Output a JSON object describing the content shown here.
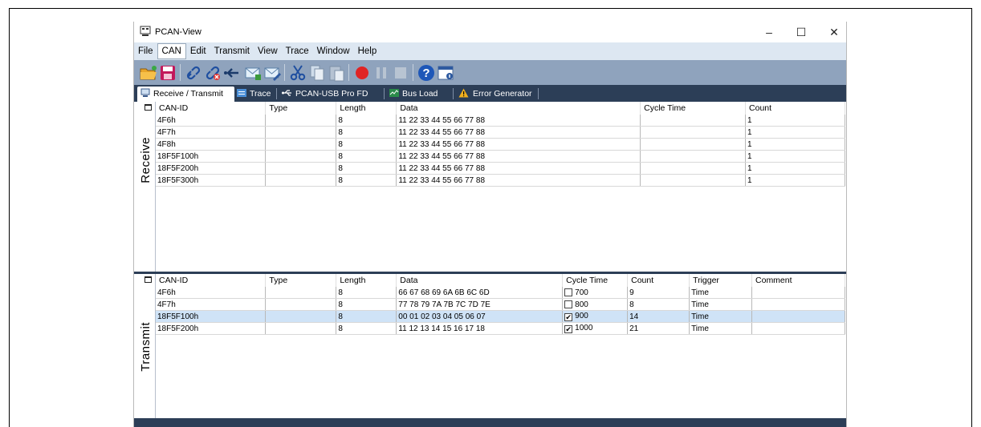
{
  "window": {
    "title": "PCAN-View",
    "minimize": "–",
    "maximize": "☐",
    "close": "✕"
  },
  "menu": [
    "File",
    "CAN",
    "Edit",
    "Transmit",
    "View",
    "Trace",
    "Window",
    "Help"
  ],
  "menu_active": "CAN",
  "toolbar": [
    "open-icon",
    "save-icon",
    "connect-icon",
    "disconnect-icon",
    "reset-icon",
    "new-message-icon",
    "edit-message-icon",
    "cut-icon",
    "copy-icon",
    "paste-icon",
    "record-icon",
    "pause-icon",
    "stop-icon",
    "help-icon",
    "about-icon"
  ],
  "tabs": [
    {
      "label": "Receive / Transmit",
      "icon": "monitor-icon"
    },
    {
      "label": "Trace",
      "icon": "trace-icon"
    },
    {
      "label": "PCAN-USB Pro FD",
      "icon": "usb-icon"
    },
    {
      "label": "Bus Load",
      "icon": "busload-icon"
    },
    {
      "label": "Error Generator",
      "icon": "warning-icon"
    }
  ],
  "receive": {
    "label": "Receive",
    "columns": [
      "CAN-ID",
      "Type",
      "Length",
      "Data",
      "Cycle Time",
      "Count"
    ],
    "rows": [
      {
        "id": "4F6h",
        "type": "",
        "length": "8",
        "data": "11 22 33 44 55 66 77 88",
        "cycle": "",
        "count": "1"
      },
      {
        "id": "4F7h",
        "type": "",
        "length": "8",
        "data": "11 22 33 44 55 66 77 88",
        "cycle": "",
        "count": "1"
      },
      {
        "id": "4F8h",
        "type": "",
        "length": "8",
        "data": "11 22 33 44 55 66 77 88",
        "cycle": "",
        "count": "1"
      },
      {
        "id": "18F5F100h",
        "type": "",
        "length": "8",
        "data": "11 22 33 44 55 66 77 88",
        "cycle": "",
        "count": "1"
      },
      {
        "id": "18F5F200h",
        "type": "",
        "length": "8",
        "data": "11 22 33 44 55 66 77 88",
        "cycle": "",
        "count": "1"
      },
      {
        "id": "18F5F300h",
        "type": "",
        "length": "8",
        "data": "11 22 33 44 55 66 77 88",
        "cycle": "",
        "count": "1"
      }
    ]
  },
  "transmit": {
    "label": "Transmit",
    "columns": [
      "CAN-ID",
      "Type",
      "Length",
      "Data",
      "Cycle Time",
      "Count",
      "Trigger",
      "Comment"
    ],
    "rows": [
      {
        "id": "4F6h",
        "type": "",
        "length": "8",
        "data": "66 67 68 69 6A 6B 6C 6D",
        "checked": false,
        "cycle": "700",
        "count": "9",
        "trigger": "Time",
        "comment": "",
        "selected": false
      },
      {
        "id": "4F7h",
        "type": "",
        "length": "8",
        "data": "77 78 79 7A 7B 7C 7D 7E",
        "checked": false,
        "cycle": "800",
        "count": "8",
        "trigger": "Time",
        "comment": "",
        "selected": false
      },
      {
        "id": "18F5F100h",
        "type": "",
        "length": "8",
        "data": "00 01 02 03 04 05 06 07",
        "checked": true,
        "cycle": "900",
        "count": "14",
        "trigger": "Time",
        "comment": "",
        "selected": true
      },
      {
        "id": "18F5F200h",
        "type": "",
        "length": "8",
        "data": "11 12 13 14 15 16 17 18",
        "checked": true,
        "cycle": "1000",
        "count": "21",
        "trigger": "Time",
        "comment": "",
        "selected": false
      }
    ]
  },
  "colors": {
    "menubar": "#dde7f2",
    "toolbar": "#8fa3bd",
    "tabbar": "#2c3e57",
    "selected_row": "#cfe3f7"
  }
}
